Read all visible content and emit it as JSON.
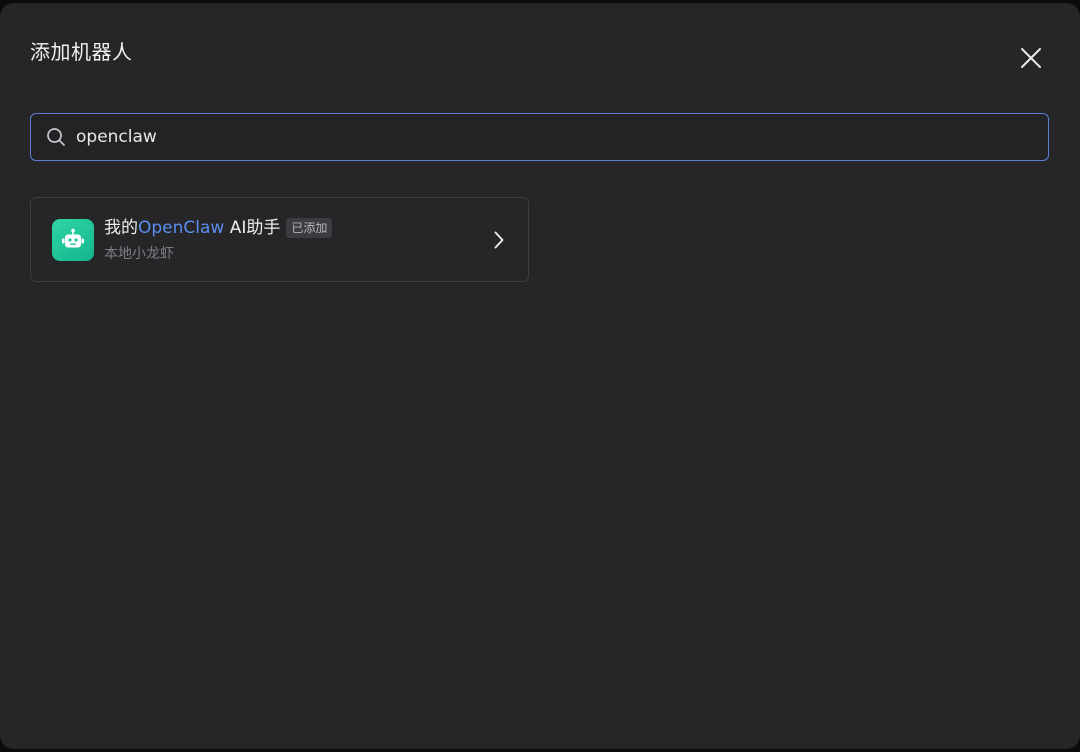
{
  "dialog": {
    "title": "添加机器人",
    "close_icon": "close-icon"
  },
  "search": {
    "icon": "search-icon",
    "value": "openclaw",
    "placeholder": ""
  },
  "results": [
    {
      "avatar_icon": "robot-icon",
      "name_prefix": "我的",
      "name_highlight": "OpenClaw",
      "name_suffix": " AI助手",
      "badge": "已添加",
      "subtitle": "本地小龙虾",
      "chevron_icon": "chevron-right-icon"
    }
  ],
  "colors": {
    "background": "#262628",
    "accent": "#5a8ff0",
    "focus_border": "#5b7fd9",
    "avatar": "#1ec79a"
  }
}
